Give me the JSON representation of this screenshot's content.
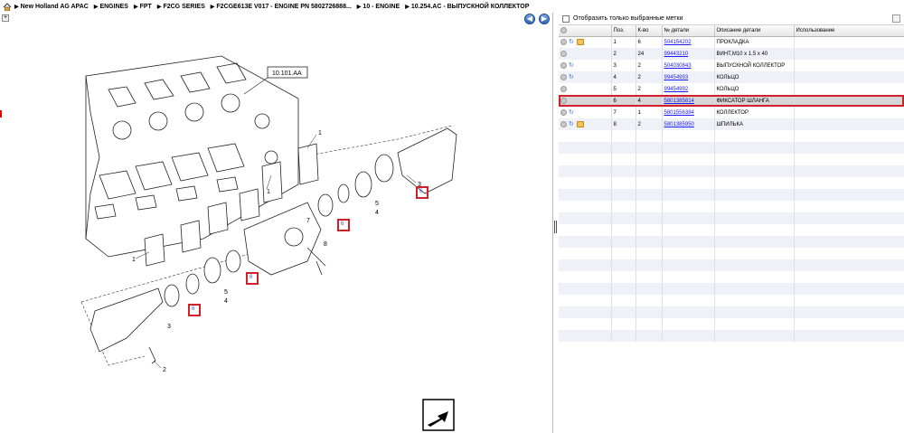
{
  "breadcrumb": [
    "New Holland AG APAC",
    "ENGINES",
    "FPT",
    "F2CG SERIES",
    "F2CGE613E V017 - ENGINE PN 5802726888...",
    "10 - ENGINE",
    "10.254.AC - ВЫПУСКНОЙ КОЛЛЕКТОР"
  ],
  "diagram": {
    "ref_label": "10.101.AA",
    "callouts": [
      "1",
      "1",
      "1",
      "2",
      "3",
      "3",
      "4",
      "4",
      "5",
      "5",
      "6",
      "6",
      "6",
      "6",
      "7",
      "8"
    ]
  },
  "filter": {
    "label": "Отобразить только выбранные метки"
  },
  "columns": [
    "Поз.",
    "К-во",
    "№ детали",
    "Описание детали",
    "Использование"
  ],
  "rows": [
    {
      "pos": "1",
      "qty": "6",
      "pn": "504154202",
      "desc": "ПРОКЛАДКА",
      "usage": "",
      "icons": [
        "circle",
        "cycle",
        "pkg"
      ]
    },
    {
      "pos": "2",
      "qty": "24",
      "pn": "99443210",
      "desc": "ВИНТ,M10 x 1.5 x 40",
      "usage": "",
      "icons": [
        "circle"
      ]
    },
    {
      "pos": "3",
      "qty": "2",
      "pn": "504030843",
      "desc": "ВЫПУСКНОЙ КОЛЛЕКТОР",
      "usage": "",
      "icons": [
        "circle",
        "cycle"
      ]
    },
    {
      "pos": "4",
      "qty": "2",
      "pn": "99454993",
      "desc": "КОЛЬЦО",
      "usage": "",
      "icons": [
        "circle",
        "cycle"
      ]
    },
    {
      "pos": "5",
      "qty": "2",
      "pn": "99454992",
      "desc": "КОЛЬЦО",
      "usage": "",
      "icons": [
        "circle"
      ]
    },
    {
      "pos": "6",
      "qty": "4",
      "pn": "5801385814",
      "desc": "ФИКСАТОР ШЛАНГА",
      "usage": "",
      "icons": [
        "circle"
      ],
      "selected": true
    },
    {
      "pos": "7",
      "qty": "1",
      "pn": "5801556384",
      "desc": "КОЛЛЕКТОР",
      "usage": "",
      "icons": [
        "circle",
        "cycle"
      ]
    },
    {
      "pos": "8",
      "qty": "2",
      "pn": "5801385950",
      "desc": "ШПИЛЬКА",
      "usage": "",
      "icons": [
        "circle",
        "cycle",
        "pkg"
      ]
    }
  ]
}
